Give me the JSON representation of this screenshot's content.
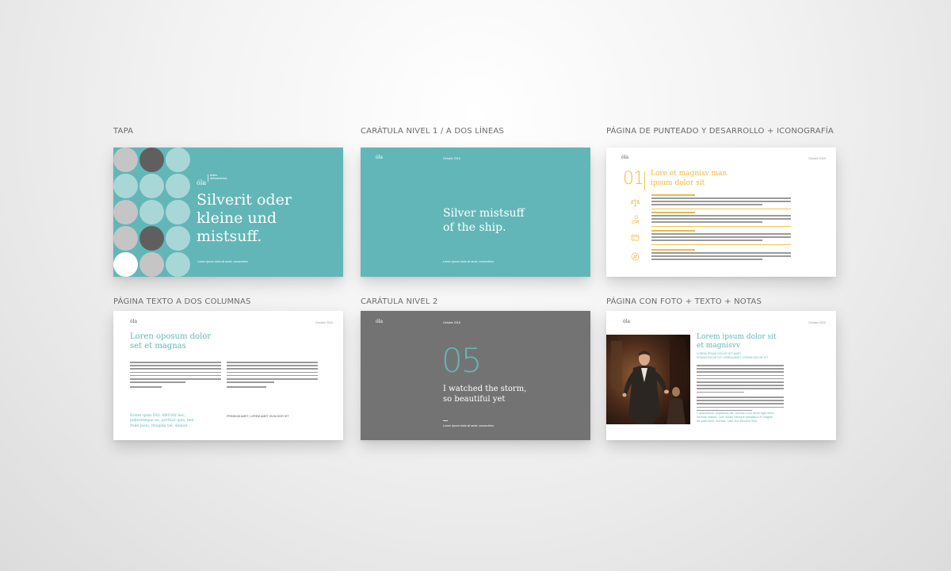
{
  "captions": {
    "tapa": "TAPA",
    "caratula1": "CARÁTULA NIVEL 1 / A DOS LÍNEAS",
    "punteado": "PÁGINA DE PUNTEADO Y DESARROLLO + ICONOGRAFÍA",
    "texto2col": "PÁGINA TEXTO A DOS COLUMNAS",
    "caratula2": "CARÁTULA NIVEL 2",
    "foto": "PÁGINA CON FOTO + TEXTO + NOTAS"
  },
  "colors": {
    "teal": "#62b6b8",
    "grey_slide": "#737373",
    "yellow_accent": "#f0b93a",
    "dot_light": "#a9d7d8",
    "dot_grey": "#c5c5c5",
    "dot_dark": "#5f5f5f",
    "dot_white": "#ffffff"
  },
  "slides": {
    "tapa": {
      "logo": "óla",
      "logo_sub_1": "teatro",
      "logo_sub_2": "latinoamérica",
      "title_1": "Silverit oder",
      "title_2": "kleine und",
      "title_3": "mistsuff.",
      "footer": "Lorem ipsum dolor sit amet, consectetur",
      "dots": [
        "light",
        "dark",
        "light",
        "grey",
        "light",
        "white",
        "light",
        "grey",
        "light",
        "dark",
        "grey",
        "light",
        "white",
        "grey",
        "dark",
        "white",
        "grey",
        "light",
        "white",
        "grey",
        "light",
        "white",
        "dark",
        "light",
        "white",
        "light",
        "light"
      ]
    },
    "caratula1": {
      "logo": "óla",
      "date": "Octubre 2016",
      "title_1": "Silver mistsuff",
      "title_2": "of the ship.",
      "footer": "Lorem ipsum dolor sit amet, consectetur"
    },
    "punteado": {
      "logo": "óla",
      "date": "Octubre 2016",
      "number": "01",
      "title_1": "Lore et magnisv man",
      "title_2": "ipsum dolor sit",
      "icons": [
        "scale-icon",
        "hand-coin-icon",
        "card-icon",
        "compass-icon"
      ]
    },
    "texto2col": {
      "logo": "óla",
      "date": "Octubre 2016",
      "title_1": "Loren oposum dolor",
      "title_2": "set et magnas",
      "highlight_1": "Erster ipsm DSL AWDSN nec,",
      "highlight_2": "pellernteque eu, porttior quis, nen.",
      "highlight_3": "Pede justo, fringilla vel, aliquet",
      "note": "PREMIUM AMET, LOREM AMET ISUM DOR SIT"
    },
    "caratula2": {
      "logo": "óla",
      "date": "Octubre 2016",
      "number": "05",
      "title_1": "I watched the storm,",
      "title_2": "so beautiful yet",
      "footer": "Lorem ipsum dolor sit amet, consectetur"
    },
    "foto": {
      "logo": "óla",
      "date": "Octubre 2016",
      "title_1": "Lorem ipsum dolor sit",
      "title_2": "et magnisvv",
      "subtitle_1": "LOREM IPSUM DOLOR SIT AMET",
      "subtitle_2": "IPSUM DOLOR SIT LOREM AMET LOREM DOLOR SIT",
      "note_1": "Consectetuer adipiscing elit. Aenean eros lacus eget dolor.",
      "note_2": "Aenean massa. Cum sociis natoque penatibus et magnis",
      "note_3": "dis parturient, montes, nasc itur ridiculus mus."
    }
  }
}
